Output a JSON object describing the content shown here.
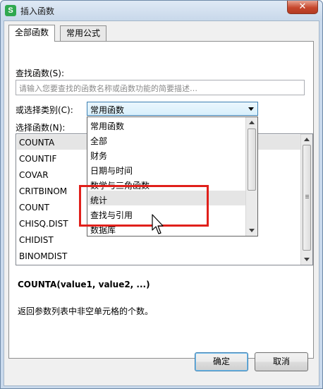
{
  "window": {
    "title": "插入函数",
    "app_icon_letter": "S",
    "close_glyph": "✕"
  },
  "tabs": [
    {
      "label": "全部函数"
    },
    {
      "label": "常用公式"
    }
  ],
  "search": {
    "label": "查找函数(S):",
    "placeholder": "请输入您要查找的函数名称或函数功能的简要描述…"
  },
  "category": {
    "label": "或选择类别(C):",
    "selected": "常用函数",
    "options": [
      "常用函数",
      "全部",
      "财务",
      "日期与时间",
      "数学与三角函数",
      "统计",
      "查找与引用",
      "数据库"
    ],
    "hovered_index": 5
  },
  "functions": {
    "label": "选择函数(N):",
    "items": [
      "COUNTA",
      "COUNTIF",
      "COVAR",
      "CRITBINOM",
      "COUNT",
      "CHISQ.DIST",
      "CHIDIST",
      "BINOMDIST"
    ],
    "selected_index": 0
  },
  "selected_function": {
    "syntax": "COUNTA(value1, value2, ...)",
    "description": "返回参数列表中非空单元格的个数。"
  },
  "buttons": {
    "ok": "确定",
    "cancel": "取消"
  },
  "colors": {
    "highlight_box": "#e0201b",
    "app_icon": "#2fa84f"
  },
  "icons": {
    "cursor": "arrow-cursor-icon"
  }
}
